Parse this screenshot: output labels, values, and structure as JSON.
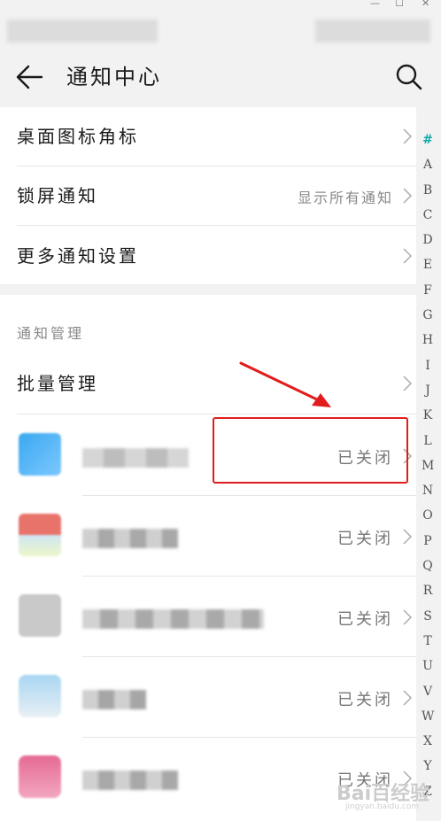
{
  "header": {
    "title": "通知中心"
  },
  "settings": [
    {
      "label": "桌面图标角标",
      "value": ""
    },
    {
      "label": "锁屏通知",
      "value": "显示所有通知"
    },
    {
      "label": "更多通知设置",
      "value": ""
    }
  ],
  "notification_management": {
    "section_title": "通知管理",
    "batch_label": "批量管理",
    "apps": [
      {
        "status": "已关闭"
      },
      {
        "status": "已关闭"
      },
      {
        "status": "已关闭"
      },
      {
        "status": "已关闭"
      },
      {
        "status": "已关闭"
      }
    ]
  },
  "index_bar": [
    "#",
    "A",
    "B",
    "C",
    "D",
    "E",
    "F",
    "G",
    "H",
    "I",
    "J",
    "K",
    "L",
    "M",
    "N",
    "O",
    "P",
    "Q",
    "R",
    "S",
    "T",
    "U",
    "V",
    "W",
    "X",
    "Y",
    "Z"
  ],
  "watermark": {
    "text": "Bai百经验",
    "url": "jingyan.baidu.com"
  },
  "colors": {
    "accent": "#13a8a8",
    "annotation": "#e21c1c"
  }
}
